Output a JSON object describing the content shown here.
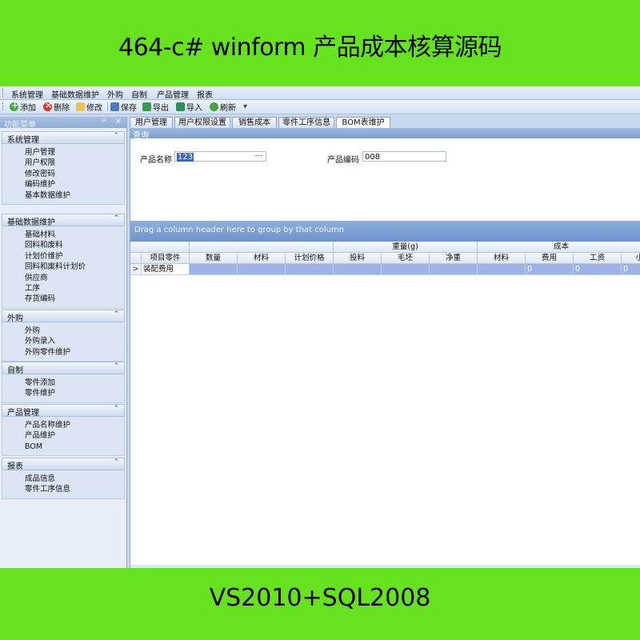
{
  "banner": {
    "top_title": "464-c# winform 产品成本核算源码",
    "bottom_title": "VS2010+SQL2008"
  },
  "menubar": [
    "系统管理",
    "基础数据维护",
    "外购",
    "自制",
    "产品管理",
    "报表"
  ],
  "toolbar": {
    "add": "添加",
    "delete": "删除",
    "edit": "修改",
    "save": "保存",
    "export": "导出",
    "import": "导入",
    "refresh": "刷新",
    "overflow": "▾"
  },
  "left_panel": {
    "title": "功能菜单",
    "pin": "ᵖ",
    "close": "✕",
    "groups": [
      {
        "name": "系统管理",
        "items": [
          "用户管理",
          "用户权限",
          "修改密码",
          "编码维护",
          "基本数据维护"
        ]
      },
      {
        "name": "基础数据维护",
        "items": [
          "基础材料",
          "回料和废料",
          "计划价维护",
          "回料和废料计划价",
          "供应商",
          "工序",
          "存货编码"
        ]
      },
      {
        "name": "外购",
        "items": [
          "外购",
          "外购录入",
          "外购零件维护"
        ]
      },
      {
        "name": "自制",
        "items": [
          "零件添加",
          "零件维护"
        ]
      },
      {
        "name": "产品管理",
        "items": [
          "产品名称维护",
          "产品维护",
          "BOM"
        ]
      },
      {
        "name": "报表",
        "items": [
          "成品信息",
          "零件工序信息"
        ]
      }
    ]
  },
  "tabs": [
    "用户管理",
    "用户权限设置",
    "销售成本",
    "零件工序信息",
    "BOM表维护"
  ],
  "query": {
    "header": "查询",
    "product_name_label": "产品名称",
    "product_name_value": "123",
    "product_name_ellipsis": "···",
    "product_code_label": "产品编码",
    "product_code_value": "008"
  },
  "grid": {
    "group_hint": "Drag a column header here to group by that column",
    "band_weight": "重量(g)",
    "band_cost": "成本",
    "columns": [
      "项目零件",
      "数量",
      "材料",
      "计划价格",
      "投料",
      "毛坯",
      "净重",
      "材料",
      "费用",
      "工资",
      "小"
    ],
    "rows": [
      {
        "indicator": ">",
        "item": "装配费用",
        "cost_fee": "0",
        "cost_wage": "0",
        "cost_small": "0"
      }
    ]
  }
}
